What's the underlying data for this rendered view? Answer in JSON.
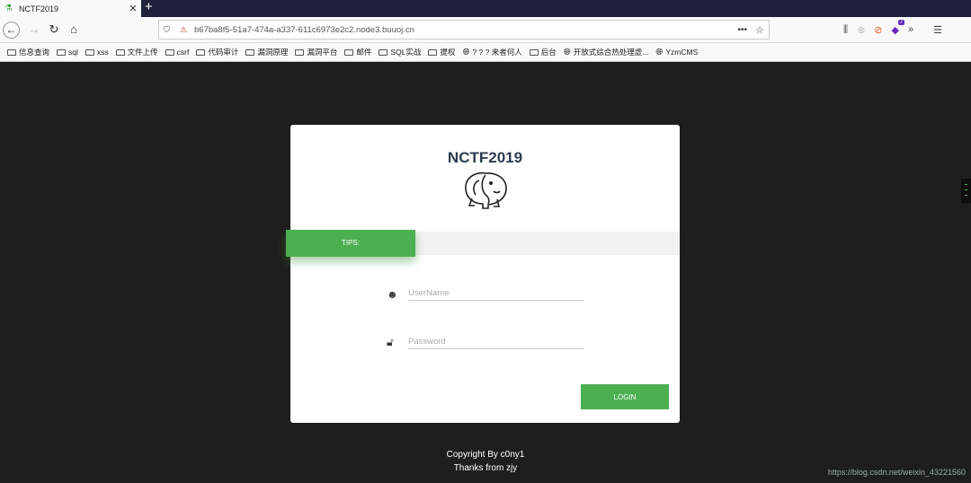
{
  "browser": {
    "tab_title": "NCTF2019",
    "tab_close": "✕",
    "new_tab": "+",
    "url": "b67ba8f5-51a7-474a-a337-611c6973e2c2.node3.buuoj.cn",
    "page_actions": "•••"
  },
  "bookmarks": [
    {
      "label": "信息查询",
      "icon": "folder-icon"
    },
    {
      "label": "sql",
      "icon": "folder-icon"
    },
    {
      "label": "xss",
      "icon": "folder-icon"
    },
    {
      "label": "文件上传",
      "icon": "folder-icon"
    },
    {
      "label": "csrf",
      "icon": "folder-icon"
    },
    {
      "label": "代码审计",
      "icon": "folder-icon"
    },
    {
      "label": "漏洞原理",
      "icon": "folder-icon"
    },
    {
      "label": "漏洞平台",
      "icon": "folder-icon"
    },
    {
      "label": "邮件",
      "icon": "folder-icon"
    },
    {
      "label": "SQL实战",
      "icon": "folder-icon"
    },
    {
      "label": "提权",
      "icon": "folder-icon"
    },
    {
      "label": "? ? ? 来者何人",
      "icon": "globe-icon"
    },
    {
      "label": "后台",
      "icon": "folder-icon"
    },
    {
      "label": "开放式综合热处理虚...",
      "icon": "globe-icon"
    },
    {
      "label": "YzmCMS",
      "icon": "globe-icon"
    }
  ],
  "extensions": {
    "badge_count": "7"
  },
  "login": {
    "title": "NCTF2019",
    "tips_label": "TIPS:",
    "username_placeholder": "UserName",
    "password_placeholder": "Password",
    "login_label": "LOGIN"
  },
  "footer": {
    "copyright": "Copyright By c0ny1",
    "thanks": "Thanks from zjy"
  },
  "watermark": "https://blog.csdn.net/weixin_43221560",
  "colors": {
    "accent": "#4caf50",
    "background": "#1e1f1c",
    "title": "#2d3b4f"
  }
}
